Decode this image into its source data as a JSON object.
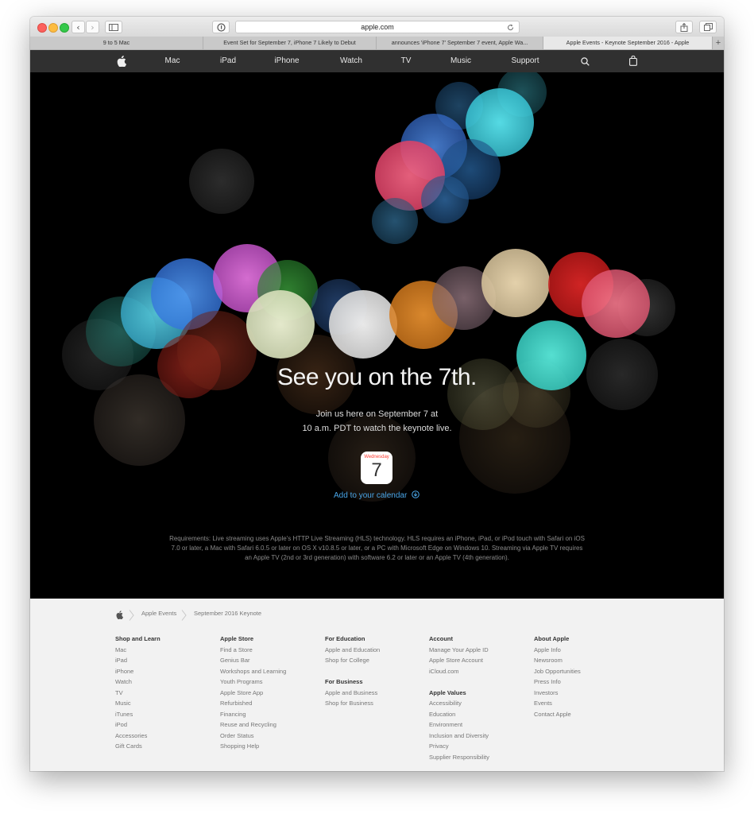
{
  "browser": {
    "url": "apple.com",
    "tabs": [
      "9 to 5 Mac",
      "Event Set for September 7, iPhone 7 Likely to Debut",
      "announces 'iPhone 7' September 7 event, Apple Wa...",
      "Apple Events - Keynote September 2016 - Apple"
    ],
    "new_tab": "+"
  },
  "nav": {
    "items": [
      "Mac",
      "iPad",
      "iPhone",
      "Watch",
      "TV",
      "Music",
      "Support"
    ]
  },
  "hero": {
    "headline": "See you on the 7th.",
    "sub_line1": "Join us here on September 7 at",
    "sub_line2": "10 a.m. PDT to watch the keynote live.",
    "calendar_day": "Wednesday",
    "calendar_date": "7",
    "add_calendar": "Add to your calendar",
    "requirements_line1": "Requirements: Live streaming uses Apple's HTTP Live Streaming (HLS) technology. HLS requires an iPhone, iPad, or iPod touch with Safari on iOS",
    "requirements_line2": "7.0 or later, a Mac with Safari 6.0.5 or later on OS X v10.8.5 or later, or a PC with Microsoft Edge on Windows 10. Streaming via Apple TV requires",
    "requirements_line3": "an Apple TV (2nd or 3rd generation) with software 6.2 or later or an Apple TV (4th generation)."
  },
  "footer": {
    "breadcrumb": [
      "Apple Events",
      "September 2016 Keynote"
    ],
    "col1": {
      "heading": "Shop and Learn",
      "items": [
        "Mac",
        "iPad",
        "iPhone",
        "Watch",
        "TV",
        "Music",
        "iTunes",
        "iPod",
        "Accessories",
        "Gift Cards"
      ]
    },
    "col2": {
      "heading": "Apple Store",
      "items": [
        "Find a Store",
        "Genius Bar",
        "Workshops and Learning",
        "Youth Programs",
        "Apple Store App",
        "Refurbished",
        "Financing",
        "Reuse and Recycling",
        "Order Status",
        "Shopping Help"
      ]
    },
    "col3": {
      "heading": "For Education",
      "items": [
        "Apple and Education",
        "Shop for College"
      ],
      "heading2": "For Business",
      "items2": [
        "Apple and Business",
        "Shop for Business"
      ]
    },
    "col4": {
      "heading": "Account",
      "items": [
        "Manage Your Apple ID",
        "Apple Store Account",
        "iCloud.com"
      ],
      "heading2": "Apple Values",
      "items2": [
        "Accessibility",
        "Education",
        "Environment",
        "Inclusion and Diversity",
        "Privacy",
        "Supplier Responsibility"
      ]
    },
    "col5": {
      "heading": "About Apple",
      "items": [
        "Apple Info",
        "Newsroom",
        "Job Opportunities",
        "Press Info",
        "Investors",
        "Events",
        "Contact Apple"
      ]
    }
  }
}
